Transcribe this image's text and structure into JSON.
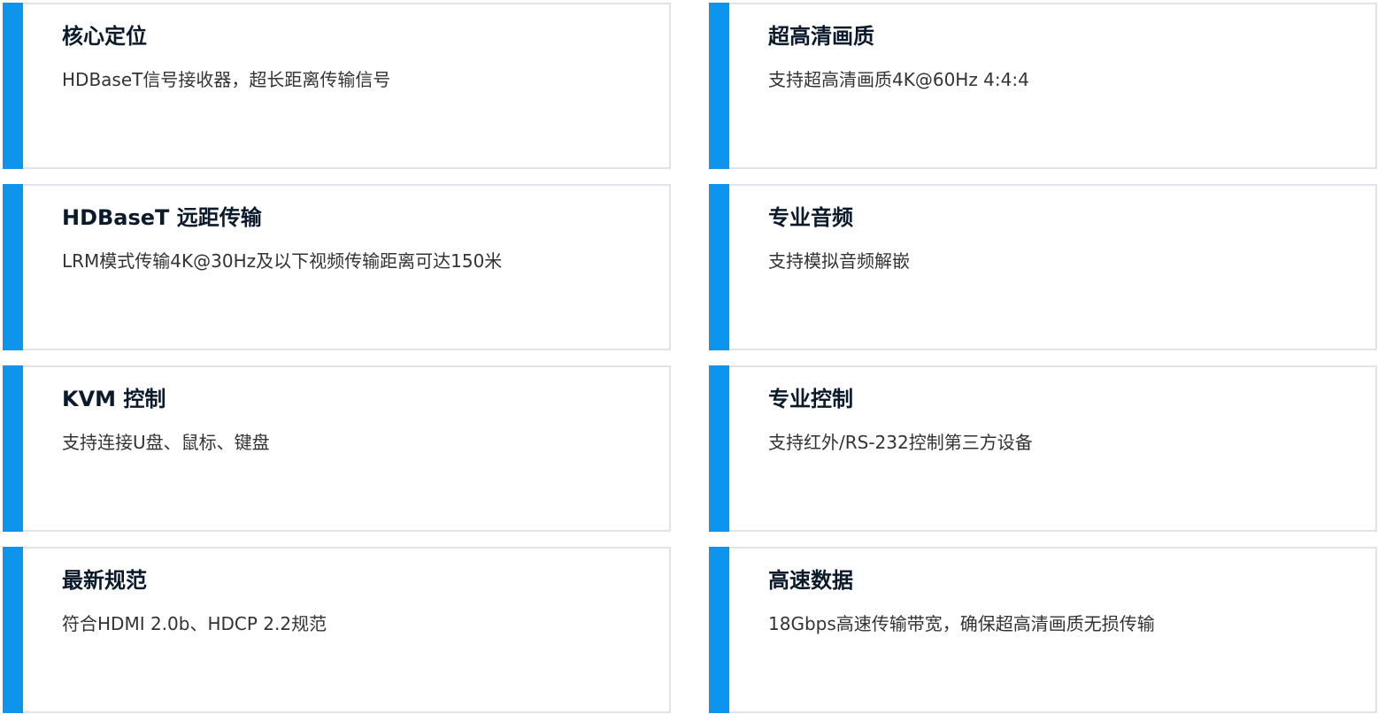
{
  "features": [
    {
      "title": "核心定位",
      "description": "HDBaseT信号接收器，超长距离传输信号"
    },
    {
      "title": "超高清画质",
      "description": "支持超高清画质4K@60Hz 4:4:4"
    },
    {
      "title": "HDBaseT 远距传输",
      "description": "LRM模式传输4K@30Hz及以下视频传输距离可达150米"
    },
    {
      "title": "专业音频",
      "description": "支持模拟音频解嵌"
    },
    {
      "title": "KVM 控制",
      "description": "支持连接U盘、鼠标、键盘"
    },
    {
      "title": "专业控制",
      "description": "支持红外/RS-232控制第三方设备"
    },
    {
      "title": "最新规范",
      "description": "符合HDMI 2.0b、HDCP 2.2规范"
    },
    {
      "title": "高速数据",
      "description": "18Gbps高速传输带宽，确保超高清画质无损传输"
    }
  ],
  "colors": {
    "accent": "#0d94ec",
    "border": "#dfe3ea",
    "title": "#0b1a2b",
    "text": "#333333"
  }
}
